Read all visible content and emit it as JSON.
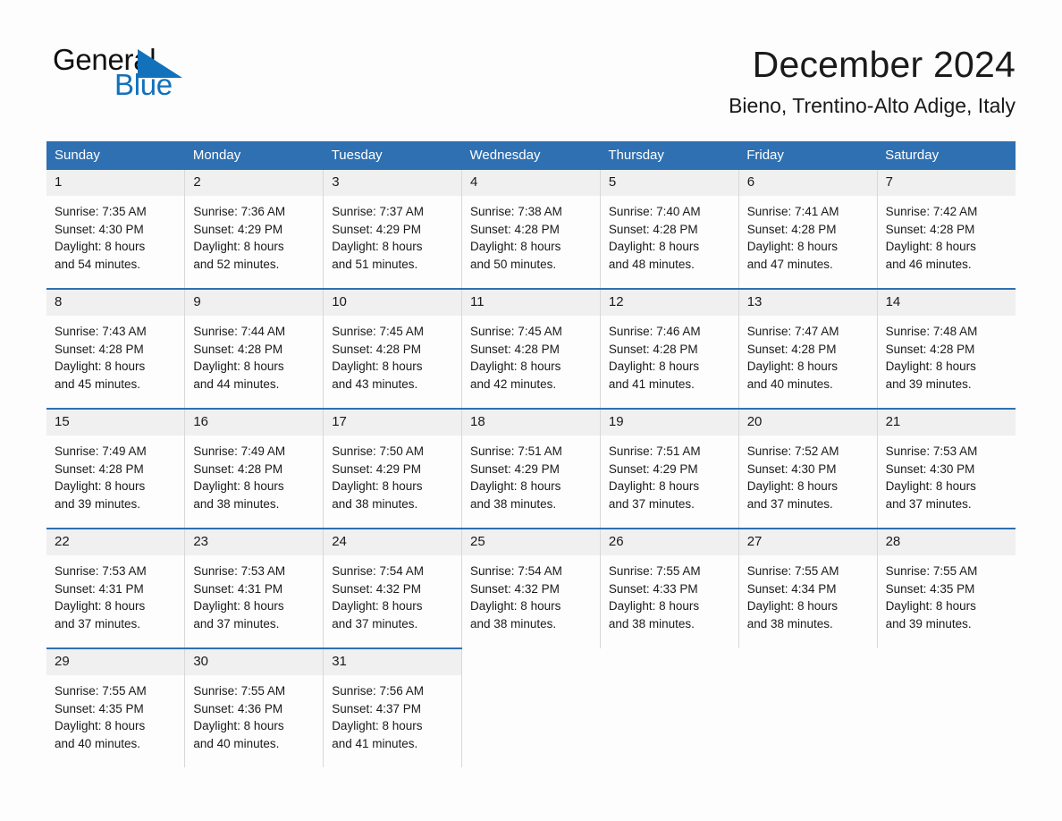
{
  "brand": {
    "name_part1": "General",
    "name_part2": "Blue",
    "logo_icon": "triangle-flag-icon",
    "accent_color": "#1271bb"
  },
  "header": {
    "title": "December 2024",
    "location": "Bieno, Trentino-Alto Adige, Italy"
  },
  "colors": {
    "header_row_bg": "#2e70b2",
    "daynum_bg": "#f0f0f0",
    "page_bg": "#fdfdfd",
    "text": "#1a1a1a",
    "week_separator": "#2e70b2"
  },
  "calendar": {
    "weekday_headers": [
      "Sunday",
      "Monday",
      "Tuesday",
      "Wednesday",
      "Thursday",
      "Friday",
      "Saturday"
    ],
    "labels": {
      "sunrise": "Sunrise:",
      "sunset": "Sunset:",
      "daylight": "Daylight:"
    },
    "weeks": [
      [
        {
          "day": "1",
          "sunrise": "Sunrise: 7:35 AM",
          "sunset": "Sunset: 4:30 PM",
          "daylight_line1": "Daylight: 8 hours",
          "daylight_line2": "and 54 minutes."
        },
        {
          "day": "2",
          "sunrise": "Sunrise: 7:36 AM",
          "sunset": "Sunset: 4:29 PM",
          "daylight_line1": "Daylight: 8 hours",
          "daylight_line2": "and 52 minutes."
        },
        {
          "day": "3",
          "sunrise": "Sunrise: 7:37 AM",
          "sunset": "Sunset: 4:29 PM",
          "daylight_line1": "Daylight: 8 hours",
          "daylight_line2": "and 51 minutes."
        },
        {
          "day": "4",
          "sunrise": "Sunrise: 7:38 AM",
          "sunset": "Sunset: 4:28 PM",
          "daylight_line1": "Daylight: 8 hours",
          "daylight_line2": "and 50 minutes."
        },
        {
          "day": "5",
          "sunrise": "Sunrise: 7:40 AM",
          "sunset": "Sunset: 4:28 PM",
          "daylight_line1": "Daylight: 8 hours",
          "daylight_line2": "and 48 minutes."
        },
        {
          "day": "6",
          "sunrise": "Sunrise: 7:41 AM",
          "sunset": "Sunset: 4:28 PM",
          "daylight_line1": "Daylight: 8 hours",
          "daylight_line2": "and 47 minutes."
        },
        {
          "day": "7",
          "sunrise": "Sunrise: 7:42 AM",
          "sunset": "Sunset: 4:28 PM",
          "daylight_line1": "Daylight: 8 hours",
          "daylight_line2": "and 46 minutes."
        }
      ],
      [
        {
          "day": "8",
          "sunrise": "Sunrise: 7:43 AM",
          "sunset": "Sunset: 4:28 PM",
          "daylight_line1": "Daylight: 8 hours",
          "daylight_line2": "and 45 minutes."
        },
        {
          "day": "9",
          "sunrise": "Sunrise: 7:44 AM",
          "sunset": "Sunset: 4:28 PM",
          "daylight_line1": "Daylight: 8 hours",
          "daylight_line2": "and 44 minutes."
        },
        {
          "day": "10",
          "sunrise": "Sunrise: 7:45 AM",
          "sunset": "Sunset: 4:28 PM",
          "daylight_line1": "Daylight: 8 hours",
          "daylight_line2": "and 43 minutes."
        },
        {
          "day": "11",
          "sunrise": "Sunrise: 7:45 AM",
          "sunset": "Sunset: 4:28 PM",
          "daylight_line1": "Daylight: 8 hours",
          "daylight_line2": "and 42 minutes."
        },
        {
          "day": "12",
          "sunrise": "Sunrise: 7:46 AM",
          "sunset": "Sunset: 4:28 PM",
          "daylight_line1": "Daylight: 8 hours",
          "daylight_line2": "and 41 minutes."
        },
        {
          "day": "13",
          "sunrise": "Sunrise: 7:47 AM",
          "sunset": "Sunset: 4:28 PM",
          "daylight_line1": "Daylight: 8 hours",
          "daylight_line2": "and 40 minutes."
        },
        {
          "day": "14",
          "sunrise": "Sunrise: 7:48 AM",
          "sunset": "Sunset: 4:28 PM",
          "daylight_line1": "Daylight: 8 hours",
          "daylight_line2": "and 39 minutes."
        }
      ],
      [
        {
          "day": "15",
          "sunrise": "Sunrise: 7:49 AM",
          "sunset": "Sunset: 4:28 PM",
          "daylight_line1": "Daylight: 8 hours",
          "daylight_line2": "and 39 minutes."
        },
        {
          "day": "16",
          "sunrise": "Sunrise: 7:49 AM",
          "sunset": "Sunset: 4:28 PM",
          "daylight_line1": "Daylight: 8 hours",
          "daylight_line2": "and 38 minutes."
        },
        {
          "day": "17",
          "sunrise": "Sunrise: 7:50 AM",
          "sunset": "Sunset: 4:29 PM",
          "daylight_line1": "Daylight: 8 hours",
          "daylight_line2": "and 38 minutes."
        },
        {
          "day": "18",
          "sunrise": "Sunrise: 7:51 AM",
          "sunset": "Sunset: 4:29 PM",
          "daylight_line1": "Daylight: 8 hours",
          "daylight_line2": "and 38 minutes."
        },
        {
          "day": "19",
          "sunrise": "Sunrise: 7:51 AM",
          "sunset": "Sunset: 4:29 PM",
          "daylight_line1": "Daylight: 8 hours",
          "daylight_line2": "and 37 minutes."
        },
        {
          "day": "20",
          "sunrise": "Sunrise: 7:52 AM",
          "sunset": "Sunset: 4:30 PM",
          "daylight_line1": "Daylight: 8 hours",
          "daylight_line2": "and 37 minutes."
        },
        {
          "day": "21",
          "sunrise": "Sunrise: 7:53 AM",
          "sunset": "Sunset: 4:30 PM",
          "daylight_line1": "Daylight: 8 hours",
          "daylight_line2": "and 37 minutes."
        }
      ],
      [
        {
          "day": "22",
          "sunrise": "Sunrise: 7:53 AM",
          "sunset": "Sunset: 4:31 PM",
          "daylight_line1": "Daylight: 8 hours",
          "daylight_line2": "and 37 minutes."
        },
        {
          "day": "23",
          "sunrise": "Sunrise: 7:53 AM",
          "sunset": "Sunset: 4:31 PM",
          "daylight_line1": "Daylight: 8 hours",
          "daylight_line2": "and 37 minutes."
        },
        {
          "day": "24",
          "sunrise": "Sunrise: 7:54 AM",
          "sunset": "Sunset: 4:32 PM",
          "daylight_line1": "Daylight: 8 hours",
          "daylight_line2": "and 37 minutes."
        },
        {
          "day": "25",
          "sunrise": "Sunrise: 7:54 AM",
          "sunset": "Sunset: 4:32 PM",
          "daylight_line1": "Daylight: 8 hours",
          "daylight_line2": "and 38 minutes."
        },
        {
          "day": "26",
          "sunrise": "Sunrise: 7:55 AM",
          "sunset": "Sunset: 4:33 PM",
          "daylight_line1": "Daylight: 8 hours",
          "daylight_line2": "and 38 minutes."
        },
        {
          "day": "27",
          "sunrise": "Sunrise: 7:55 AM",
          "sunset": "Sunset: 4:34 PM",
          "daylight_line1": "Daylight: 8 hours",
          "daylight_line2": "and 38 minutes."
        },
        {
          "day": "28",
          "sunrise": "Sunrise: 7:55 AM",
          "sunset": "Sunset: 4:35 PM",
          "daylight_line1": "Daylight: 8 hours",
          "daylight_line2": "and 39 minutes."
        }
      ],
      [
        {
          "day": "29",
          "sunrise": "Sunrise: 7:55 AM",
          "sunset": "Sunset: 4:35 PM",
          "daylight_line1": "Daylight: 8 hours",
          "daylight_line2": "and 40 minutes."
        },
        {
          "day": "30",
          "sunrise": "Sunrise: 7:55 AM",
          "sunset": "Sunset: 4:36 PM",
          "daylight_line1": "Daylight: 8 hours",
          "daylight_line2": "and 40 minutes."
        },
        {
          "day": "31",
          "sunrise": "Sunrise: 7:56 AM",
          "sunset": "Sunset: 4:37 PM",
          "daylight_line1": "Daylight: 8 hours",
          "daylight_line2": "and 41 minutes."
        },
        {
          "day": "",
          "sunrise": "",
          "sunset": "",
          "daylight_line1": "",
          "daylight_line2": ""
        },
        {
          "day": "",
          "sunrise": "",
          "sunset": "",
          "daylight_line1": "",
          "daylight_line2": ""
        },
        {
          "day": "",
          "sunrise": "",
          "sunset": "",
          "daylight_line1": "",
          "daylight_line2": ""
        },
        {
          "day": "",
          "sunrise": "",
          "sunset": "",
          "daylight_line1": "",
          "daylight_line2": ""
        }
      ]
    ]
  }
}
